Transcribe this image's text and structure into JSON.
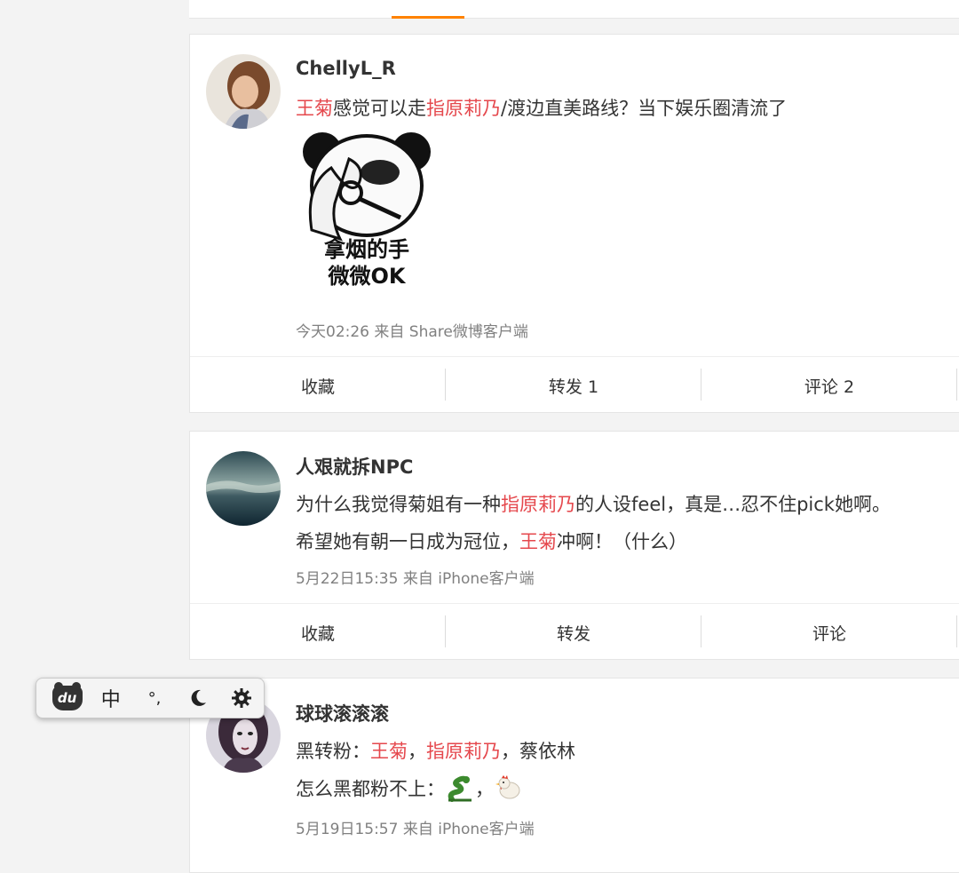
{
  "posts": [
    {
      "username": "ChellyL_R",
      "line1": [
        "王菊",
        "感觉可以走",
        "指原莉乃",
        "/渡边直美路线？当下娱乐圈清流了"
      ],
      "meme_text_1": "拿烟的手",
      "meme_text_2": "微微OK",
      "meta": "今天02:26 来自 Share微博客户端",
      "actions": [
        "收藏",
        "转发 1",
        "评论 2"
      ]
    },
    {
      "username": "人艰就拆NPC",
      "line1": [
        "为什么我觉得菊姐有一种",
        "指原莉乃",
        "的人设feel，真是…忍不住pick她啊。"
      ],
      "line2": [
        "希望她有朝一日成为冠位，",
        "王菊",
        "冲啊！（什么）"
      ],
      "meta": "5月22日15:35 来自 iPhone客户端",
      "actions": [
        "收藏",
        "转发",
        "评论"
      ]
    },
    {
      "username": "球球滚滚滚",
      "line1": [
        "黑转粉：",
        "王菊",
        "，",
        "指原莉乃",
        "，蔡依林"
      ],
      "line2": [
        "怎么黑都粉不上：",
        "，"
      ],
      "meta": "5月19日15:57 来自 iPhone客户端"
    }
  ],
  "ime_toolbar": {
    "logo": "du",
    "lang": "中",
    "punct": "°,",
    "icons": [
      "du-logo-icon",
      "moon-icon",
      "gear-icon"
    ]
  },
  "colors": {
    "accent": "#ff8200",
    "highlight": "#e5484d"
  }
}
